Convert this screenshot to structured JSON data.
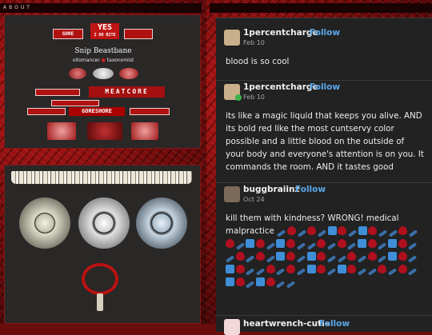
{
  "left_panel": {
    "header_strip": "ABOUT",
    "badges": {
      "gore": "GORE",
      "yes_line1": "YES",
      "yes_line2": "I DO BITE",
      "meat_title": "MEATCORE",
      "goreshore": "GORESHORE"
    },
    "name": "Snip Beastbane",
    "subtitle_left": "vitomancer",
    "subtitle_right": "taxonomist"
  },
  "feed": {
    "posts": [
      {
        "user": "1percentcharge",
        "follow": "Follow",
        "date": "Feb 10",
        "text": "blood is so cool"
      },
      {
        "user": "1percentcharge",
        "follow": "Follow",
        "date": "Feb 10",
        "text": "its like a magic liquid that keeps you alive. AND its bold red like the most cuntservy color possible and a little blood on the outside of your body and everyone's attention is on you. It commands the room. AND it tastes good"
      },
      {
        "user": "buggbraiinz",
        "follow": "Follow",
        "date": "Oct 24",
        "text": "kill them with kindness? WRONG! medical malpractice"
      },
      {
        "user": "heartwrench-cutie",
        "follow": "Follow",
        "date": "",
        "text": ""
      }
    ],
    "emoji_pattern": [
      "syringe",
      "blood",
      "syringe",
      "blood",
      "syringe",
      "hospital",
      "blood",
      "syringe",
      "hospital",
      "blood",
      "syringe"
    ]
  }
}
